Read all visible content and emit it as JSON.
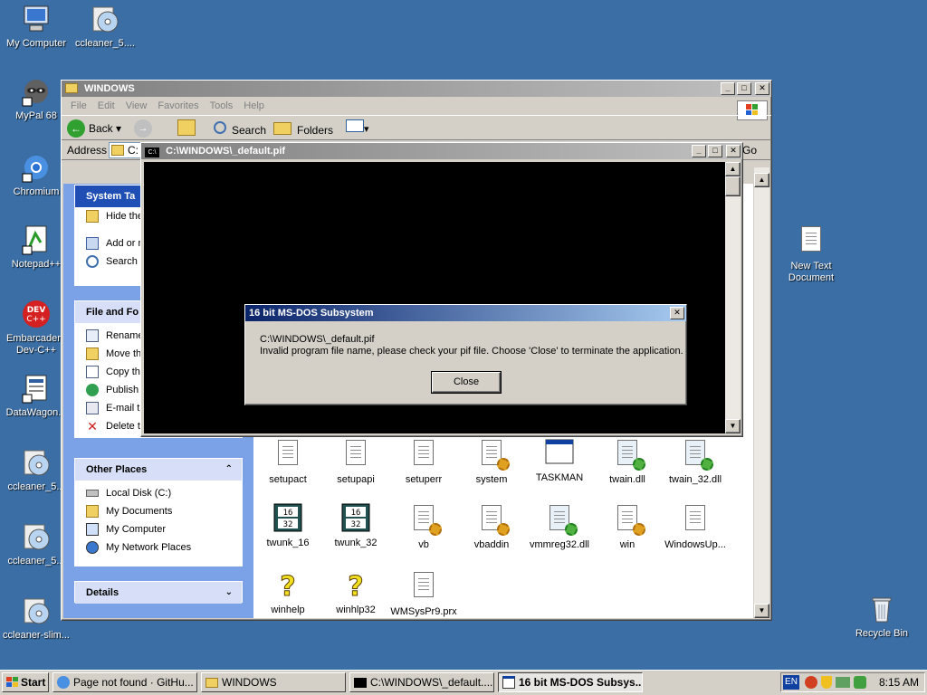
{
  "desktop": {
    "icons": [
      {
        "label": "My Computer"
      },
      {
        "label": "ccleaner_5...."
      },
      {
        "label": "MyPal 68"
      },
      {
        "label": "Chromium"
      },
      {
        "label": "Notepad++"
      },
      {
        "label": "Embarcadero Dev-C++"
      },
      {
        "label": "DataWagon..."
      },
      {
        "label": "ccleaner_5..."
      },
      {
        "label": "ccleaner_5..."
      },
      {
        "label": "ccleaner-slim..."
      },
      {
        "label": "New Text Document"
      },
      {
        "label": "Recycle Bin"
      }
    ]
  },
  "explorer": {
    "title": "WINDOWS",
    "menu": [
      "File",
      "Edit",
      "View",
      "Favorites",
      "Tools",
      "Help"
    ],
    "toolbar": {
      "back": "Back",
      "search": "Search",
      "folders": "Folders"
    },
    "address_label": "Address",
    "address_value": "C:",
    "go_label": "Go",
    "system_tasks": {
      "header": "System Ta",
      "items": [
        "Hide the folder",
        "Add or r",
        "Search"
      ]
    },
    "file_tasks": {
      "header": "File and Fo",
      "items": [
        "Rename",
        "Move th",
        "Copy th",
        "Publish",
        "E-mail th",
        "Delete t"
      ]
    },
    "other_places": {
      "header": "Other Places",
      "items": [
        "Local Disk (C:)",
        "My Documents",
        "My Computer",
        "My Network Places"
      ]
    },
    "details": {
      "header": "Details"
    },
    "files": [
      {
        "label": "setupact"
      },
      {
        "label": "setupapi"
      },
      {
        "label": "setuperr"
      },
      {
        "label": "system"
      },
      {
        "label": "TASKMAN"
      },
      {
        "label": "twain.dll"
      },
      {
        "label": "twain_32.dll"
      },
      {
        "label": "twunk_16"
      },
      {
        "label": "twunk_32"
      },
      {
        "label": "vb"
      },
      {
        "label": "vbaddin"
      },
      {
        "label": "vmmreg32.dll"
      },
      {
        "label": "win"
      },
      {
        "label": "WindowsUp..."
      },
      {
        "label": "winhelp"
      },
      {
        "label": "winhlp32"
      },
      {
        "label": "WMSysPr9.prx"
      }
    ]
  },
  "console": {
    "title": "C:\\WINDOWS\\_default.pif",
    "icon_text": "C:\\"
  },
  "dialog": {
    "title": "16 bit MS-DOS Subsystem",
    "line1": "C:\\WINDOWS\\_default.pif",
    "line2": "Invalid program file name, please check your pif file. Choose 'Close' to terminate the application.",
    "close_button": "Close"
  },
  "taskbar": {
    "start": "Start",
    "tasks": [
      {
        "label": "Page not found · GitHu..."
      },
      {
        "label": "WINDOWS"
      },
      {
        "label": "C:\\WINDOWS\\_default...."
      },
      {
        "label": "16 bit MS-DOS Subsys..."
      }
    ],
    "lang": "EN",
    "clock": "8:15 AM"
  }
}
